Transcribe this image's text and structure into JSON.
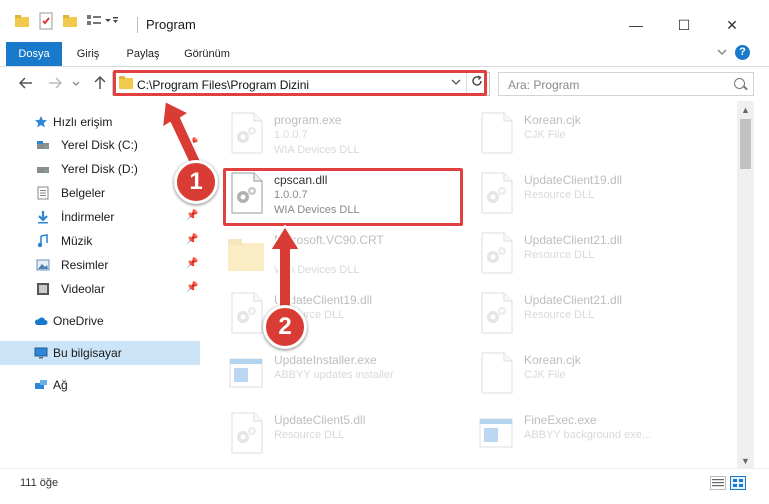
{
  "window": {
    "title": "Program",
    "controls": {
      "minimize": "—",
      "maximize": "☐",
      "close": "✕"
    }
  },
  "ribbon": {
    "tabs": [
      "Dosya",
      "Giriş",
      "Paylaş",
      "Görünüm"
    ],
    "active": "Dosya",
    "help": "?"
  },
  "nav": {
    "address": "C:\\Program Files\\Program Dizini",
    "search_placeholder": "Ara: Program"
  },
  "sidebar": {
    "items": [
      {
        "label": "Hızlı erişim",
        "icon": "star-icon",
        "pinned": false
      },
      {
        "label": "Yerel Disk (C:)",
        "icon": "drive-icon",
        "pinned": true
      },
      {
        "label": "Yerel Disk (D:)",
        "icon": "drive-icon",
        "pinned": false
      },
      {
        "label": "Belgeler",
        "icon": "documents-icon",
        "pinned": true
      },
      {
        "label": "İndirmeler",
        "icon": "download-icon",
        "pinned": true
      },
      {
        "label": "Müzik",
        "icon": "music-icon",
        "pinned": true
      },
      {
        "label": "Resimler",
        "icon": "pictures-icon",
        "pinned": true
      },
      {
        "label": "Videolar",
        "icon": "video-icon",
        "pinned": true
      },
      {
        "label": "OneDrive",
        "icon": "cloud-icon",
        "pinned": false
      },
      {
        "label": "Bu bilgisayar",
        "icon": "computer-icon",
        "pinned": false,
        "selected": true
      },
      {
        "label": "Ağ",
        "icon": "network-icon",
        "pinned": false
      }
    ]
  },
  "files": [
    {
      "name": "program.exe",
      "line1": "1.0.0.7",
      "line2": "WIA Devices DLL",
      "type": "gear-file-icon",
      "faded": true
    },
    {
      "name": "Korean.cjk",
      "line1": "CJK File",
      "line2": "",
      "type": "blank-file-icon",
      "faded": true
    },
    {
      "name": "cpscan.dll",
      "line1": "1.0.0.7",
      "line2": "WIA Devices DLL",
      "type": "gear-file-icon",
      "faded": false
    },
    {
      "name": "UpdateClient19.dll",
      "line1": "Resource DLL",
      "line2": "",
      "type": "gear-file-icon",
      "faded": true
    },
    {
      "name": "Microsoft.VC90.CRT",
      "line1": "",
      "line2": "WIA Devices DLL",
      "type": "folder-icon",
      "faded": true
    },
    {
      "name": "UpdateClient21.dll",
      "line1": "Resource DLL",
      "line2": "",
      "type": "gear-file-icon",
      "faded": true
    },
    {
      "name": "UpdateClient19.dll",
      "line1": "Resource DLL",
      "line2": "",
      "type": "gear-file-icon",
      "faded": true
    },
    {
      "name": "UpdateClient21.dll",
      "line1": "Resource DLL",
      "line2": "",
      "type": "gear-file-icon",
      "faded": true
    },
    {
      "name": "UpdateInstaller.exe",
      "line1": "ABBYY updates installer",
      "line2": "",
      "type": "window-app-icon",
      "faded": true
    },
    {
      "name": "Korean.cjk",
      "line1": "CJK File",
      "line2": "",
      "type": "blank-file-icon",
      "faded": true
    },
    {
      "name": "UpdateClient5.dll",
      "line1": "Resource DLL",
      "line2": "",
      "type": "gear-file-icon",
      "faded": true
    },
    {
      "name": "FineExec.exe",
      "line1": "ABBYY background exe...",
      "line2": "",
      "type": "window-app-icon",
      "faded": true
    }
  ],
  "status": {
    "count": "111 öğe"
  },
  "annotations": {
    "badge1": "1",
    "badge2": "2",
    "color": "#d93c34"
  }
}
